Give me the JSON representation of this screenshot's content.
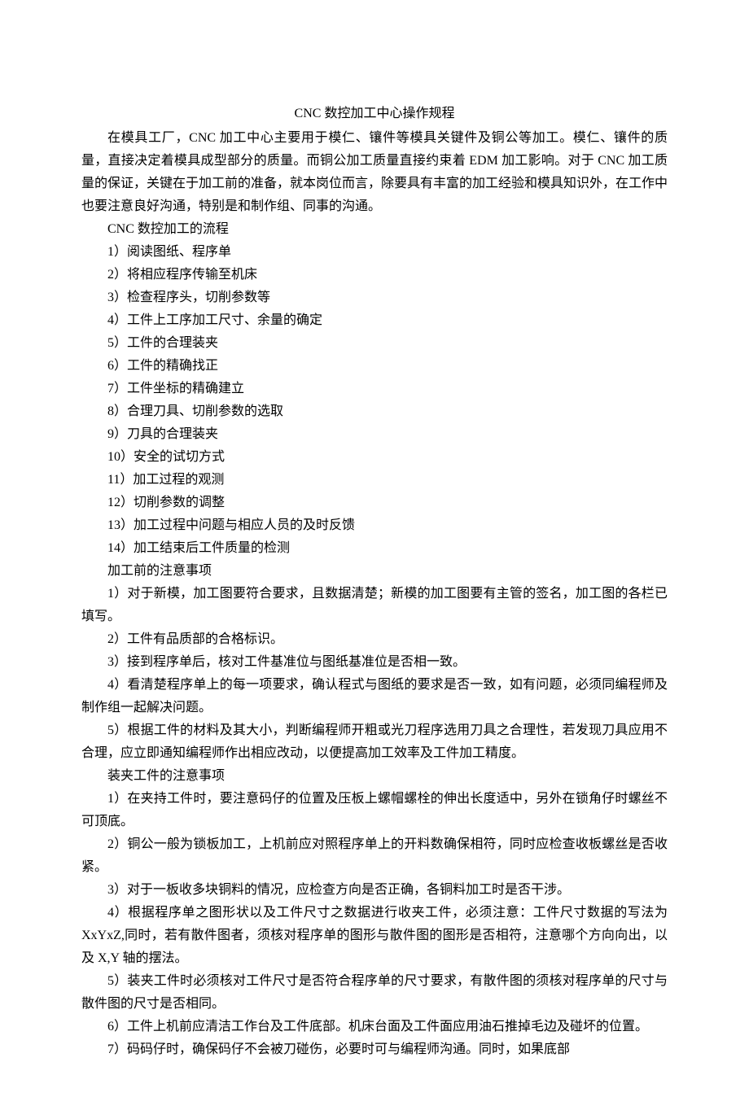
{
  "title": "CNC 数控加工中心操作规程",
  "intro": "在模具工厂，CNC 加工中心主要用于模仁、镶件等模具关键件及铜公等加工。模仁、镶件的质量，直接决定着模具成型部分的质量。而铜公加工质量直接约束着 EDM 加工影响。对于 CNC 加工质量的保证，关键在于加工前的准备，就本岗位而言，除要具有丰富的加工经验和模具知识外，在工作中也要注意良好沟通，特别是和制作组、同事的沟通。",
  "section1_heading": "CNC 数控加工的流程",
  "process": [
    "1）阅读图纸、程序单",
    "2）将相应程序传输至机床",
    "3）检查程序头，切削参数等",
    "4）工件上工序加工尺寸、余量的确定",
    "5）工件的合理装夹",
    "6）工件的精确找正",
    "7）工件坐标的精确建立",
    "8）合理刀具、切削参数的选取",
    "9）刀具的合理装夹",
    "10）安全的试切方式",
    "11）加工过程的观测",
    "12）切削参数的调整",
    "13）加工过程中问题与相应人员的及时反馈",
    "14）加工结束后工件质量的检测"
  ],
  "section2_heading": "加工前的注意事项",
  "preprocess": [
    "1）对于新模，加工图要符合要求，且数据清楚；新模的加工图要有主管的签名，加工图的各栏已填写。",
    "2）工件有品质部的合格标识。",
    "3）接到程序单后，核对工件基准位与图纸基准位是否相一致。",
    "4）看清楚程序单上的每一项要求，确认程式与图纸的要求是否一致，如有问题，必须同编程师及制作组一起解决问题。",
    "5）根据工件的材料及其大小，判断编程师开粗或光刀程序选用刀具之合理性，若发现刀具应用不合理，应立即通知编程师作出相应改动，以便提高加工效率及工件加工精度。"
  ],
  "section3_heading": "装夹工件的注意事项",
  "clamping": [
    "1）在夹持工件时，要注意码仔的位置及压板上螺帽螺栓的伸出长度适中，另外在锁角仔时螺丝不可顶底。",
    "2）铜公一般为锁板加工，上机前应对照程序单上的开料数确保相符，同时应检查收板螺丝是否收紧。",
    "3）对于一板收多块铜料的情况，应检查方向是否正确，各铜料加工时是否干涉。",
    "4）根据程序单之图形状以及工件尺寸之数据进行收夹工件，必须注意：工件尺寸数据的写法为 XxYxZ,同时，若有散件图者，须核对程序单的图形与散件图的图形是否相符，注意哪个方向向出，以及 X,Y 轴的摆法。",
    "5）装夹工件时必须核对工件尺寸是否符合程序单的尺寸要求，有散件图的须核对程序单的尺寸与散件图的尺寸是否相同。",
    "6）工件上机前应清洁工作台及工件底部。机床台面及工件面应用油石推掉毛边及碰坏的位置。",
    "7）码码仔时，确保码仔不会被刀碰伤，必要时可与编程师沟通。同时，如果底部"
  ]
}
